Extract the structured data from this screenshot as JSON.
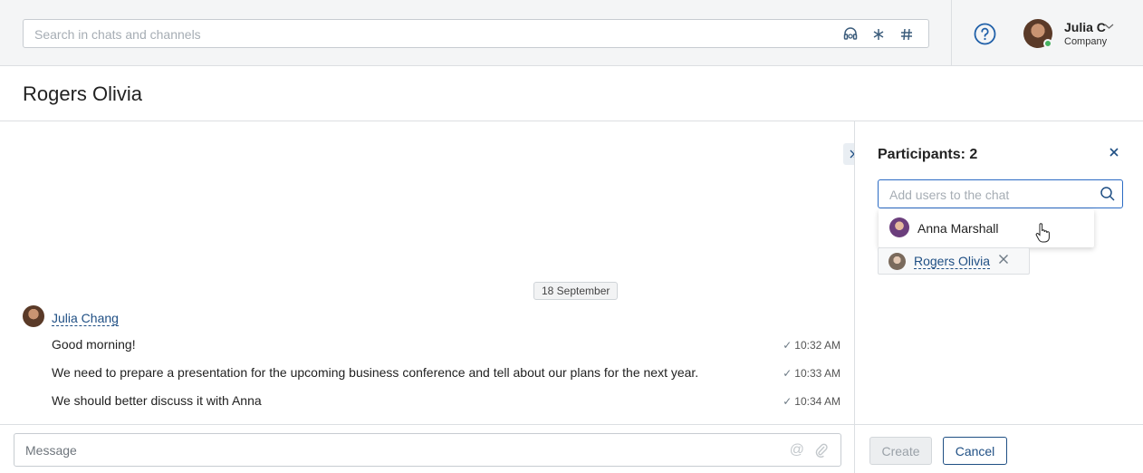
{
  "header": {
    "search_placeholder": "Search in chats and channels",
    "search_icons": [
      "headset-icon",
      "asterisk-icon",
      "hash-icon"
    ],
    "user": {
      "name": "Julia C",
      "company": "Company",
      "status": "online"
    }
  },
  "page": {
    "title": "Rogers Olivia"
  },
  "chat": {
    "date_label": "18 September",
    "author": "Julia Chang",
    "messages": [
      {
        "text": "Good morning!",
        "time": "10:32 AM"
      },
      {
        "text": "We need to prepare a presentation for the upcoming business conference and tell about our plans for the next year.",
        "time": "10:33 AM"
      },
      {
        "text": "We should better discuss it with Anna",
        "time": "10:34 AM"
      }
    ]
  },
  "composer": {
    "placeholder": "Message"
  },
  "panel": {
    "title": "Participants: 2",
    "add_placeholder": "Add users to the chat",
    "suggestion": "Anna Marshall",
    "participants": [
      "Rogers Olivia"
    ],
    "create_label": "Create",
    "cancel_label": "Cancel"
  },
  "colors": {
    "accent": "#1f4f84",
    "focus": "#2b6bc4",
    "online": "#46b160"
  }
}
